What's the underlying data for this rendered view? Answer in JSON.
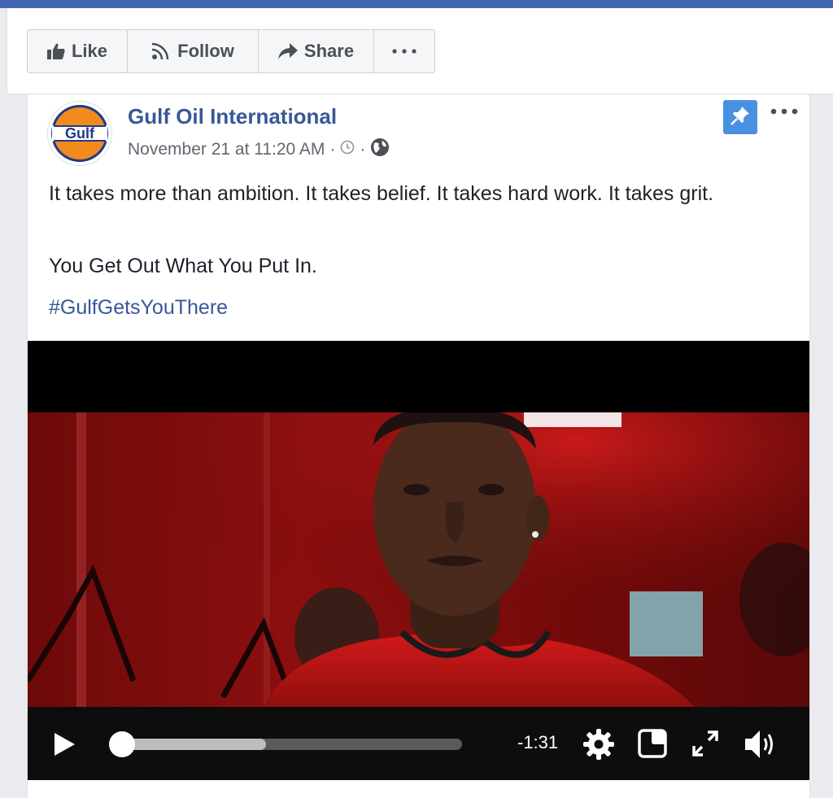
{
  "header": {
    "buttons": {
      "like": "Like",
      "follow": "Follow",
      "share": "Share"
    }
  },
  "post": {
    "page_name": "Gulf Oil International",
    "avatar_text": "Gulf",
    "timestamp": "November 21 at 11:20 AM",
    "separator": "·",
    "text_lines": [
      "It takes more than ambition. It takes belief. It takes hard work. It takes grit.",
      "You Get Out What You Put In."
    ],
    "hashtag": "#GulfGetsYouThere"
  },
  "video": {
    "time_remaining": "-1:31",
    "played_fraction": 0.0,
    "buffered_fraction": 0.43
  },
  "colors": {
    "facebook_blue": "#4267b2",
    "link_blue": "#385898",
    "pin_blue": "#4a90e2",
    "gulf_orange": "#f28a1e",
    "gulf_navy": "#1f3a8a"
  }
}
